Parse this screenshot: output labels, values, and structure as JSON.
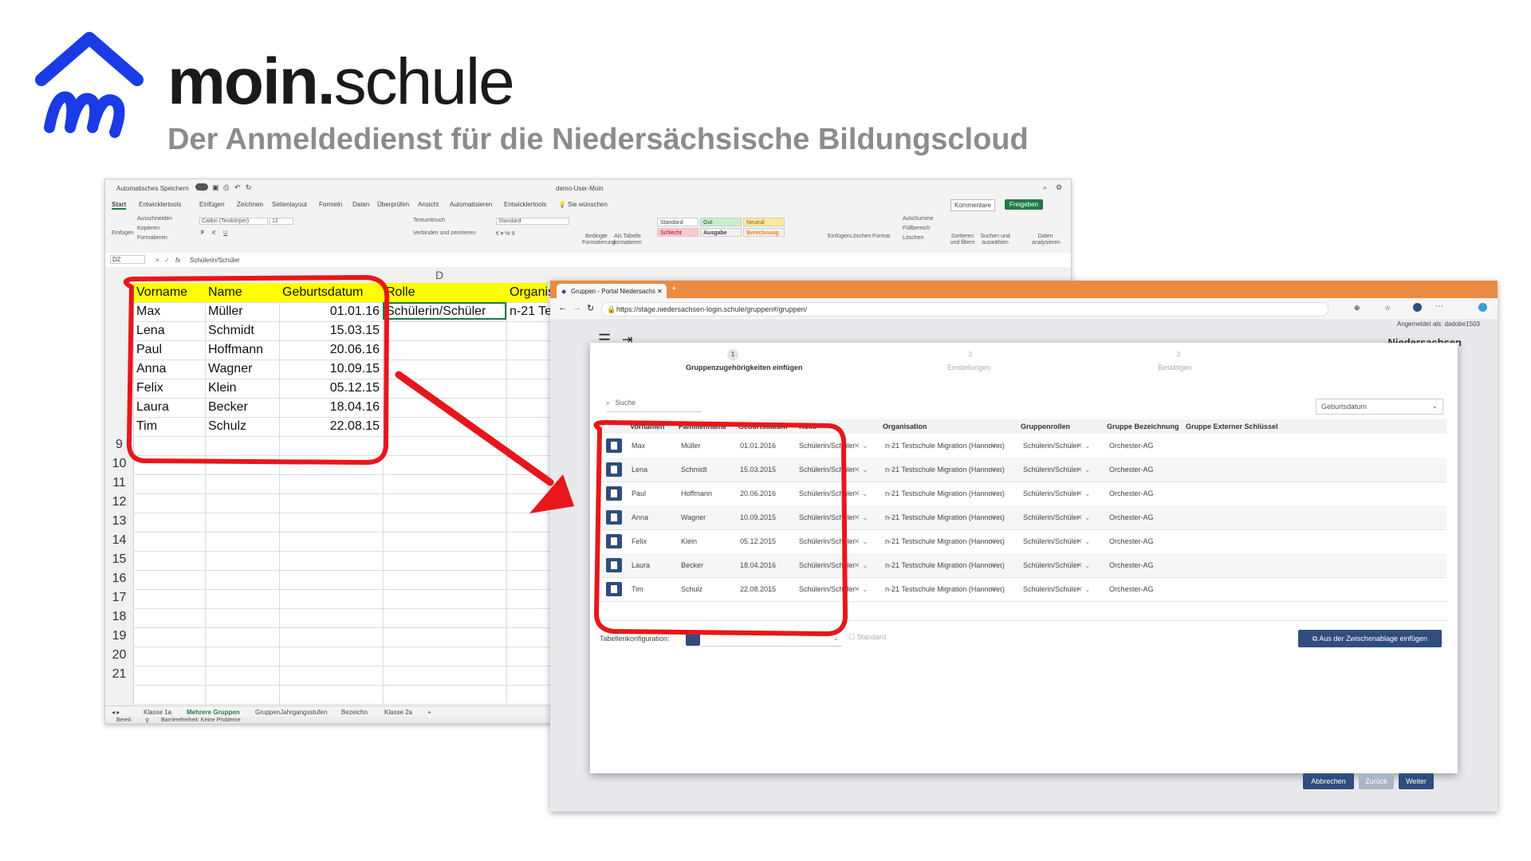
{
  "header": {
    "brand_bold": "moin.",
    "brand_light": "schule",
    "tagline": "Der Anmeldedienst für die Niedersächsische Bildungscloud"
  },
  "excel": {
    "autosave": "Automatisches Speichern",
    "filename": "demo-User-Moin",
    "tabs": [
      "Start",
      "Entwicklertools",
      "Einfügen",
      "Zeichnen",
      "Seitenlayout",
      "Formeln",
      "Daten",
      "Überprüfen",
      "Ansicht",
      "Automatisieren",
      "Entwicklertools"
    ],
    "tell_me": "Sie wünschen",
    "comments": "Kommentare",
    "share": "Freigeben",
    "clipboard": [
      "Ausschneiden",
      "Kopieren",
      "Formatieren"
    ],
    "paste": "Einfügen",
    "font_name": "Calibri (Textkörper)",
    "font_size": "12",
    "wrap": "Textumbruch",
    "merge": "Verbinden und zentrieren",
    "number_format": "Standard",
    "cond_format": "Bedingte Formatierung",
    "as_table": "Als Tabelle formatieren",
    "styles": {
      "standard": "Standard",
      "gut": "Gut",
      "neutral": "Neutral",
      "schlecht": "Schlecht",
      "ausgabe": "Ausgabe",
      "berechnung": "Berechnung"
    },
    "cells_group": [
      "Einfügen",
      "Löschen",
      "Format"
    ],
    "autosum": "AutoSumme",
    "fill": "Füllbereich",
    "clear": "Löschen",
    "sort": "Sortieren und filtern",
    "find": "Suchen und auswählen",
    "analyze": "Daten analysieren",
    "cell_ref": "D2",
    "fx": "fx",
    "formula": "Schülerin/Schüler",
    "col_d": "D",
    "headers": [
      "Vorname",
      "Name",
      "Geburtsdatum",
      "Rolle",
      "Organis"
    ],
    "rows": [
      {
        "vorname": "Max",
        "name": "Müller",
        "datum": "01.01.16",
        "rolle": "Schülerin/Schüler",
        "org": "n-21 Te"
      },
      {
        "vorname": "Lena",
        "name": "Schmidt",
        "datum": "15.03.15"
      },
      {
        "vorname": "Paul",
        "name": "Hoffmann",
        "datum": "20.06.16"
      },
      {
        "vorname": "Anna",
        "name": "Wagner",
        "datum": "10.09.15"
      },
      {
        "vorname": "Felix",
        "name": "Klein",
        "datum": "05.12.15"
      },
      {
        "vorname": "Laura",
        "name": "Becker",
        "datum": "18.04.16"
      },
      {
        "vorname": "Tim",
        "name": "Schulz",
        "datum": "22.08.15"
      }
    ],
    "row_numbers": [
      "9",
      "10",
      "11",
      "12",
      "13",
      "14",
      "15",
      "16",
      "17",
      "18",
      "19",
      "20",
      "21"
    ],
    "sheet_tabs": [
      "Klasse 1a",
      "Mehrere Gruppen",
      "GruppenJahrgangsstufen",
      "Bezeichn",
      "Klasse 2a",
      "+"
    ],
    "status": "Bereit",
    "accessibility": "Barrierefreiheit: Keine Probleme"
  },
  "browser": {
    "tab_title": "Gruppen - Portal Niedersachs",
    "url": "https://stage.niedersachsen-login.schule/gruppen#/gruppen/",
    "logged_in": "Angemeldet als: dadobe1503",
    "state_name": "Niedersachsen",
    "steps": [
      {
        "num": "1",
        "label": "Gruppenzugehörigkeiten einfügen"
      },
      {
        "num": "2",
        "label": "Einstellungen"
      },
      {
        "num": "3",
        "label": "Bestätigen"
      }
    ],
    "search_placeholder": "Suche",
    "sort_value": "Geburtsdatum",
    "columns": [
      "Vornamen",
      "Familienname",
      "Geburtsdatum",
      "Rolle",
      "Organisation",
      "Gruppenrollen",
      "Gruppe Bezeichnung",
      "Gruppe Externer Schlüssel"
    ],
    "rows": [
      {
        "vorname": "Max",
        "familienname": "Müller",
        "geburtsdatum": "01.01.2016",
        "rolle": "Schülerin/Schüler",
        "organisation": "n-21 Testschule Migration (Hannover)",
        "gruppenrolle": "Schülerin/Schüler",
        "gruppe": "Orchester-AG"
      },
      {
        "vorname": "Lena",
        "familienname": "Schmidt",
        "geburtsdatum": "15.03.2015",
        "rolle": "Schülerin/Schüler",
        "organisation": "n-21 Testschule Migration (Hannover)",
        "gruppenrolle": "Schülerin/Schüler",
        "gruppe": "Orchester-AG"
      },
      {
        "vorname": "Paul",
        "familienname": "Hoffmann",
        "geburtsdatum": "20.06.2016",
        "rolle": "Schülerin/Schüler",
        "organisation": "n-21 Testschule Migration (Hannover)",
        "gruppenrolle": "Schülerin/Schüler",
        "gruppe": "Orchester-AG"
      },
      {
        "vorname": "Anna",
        "familienname": "Wagner",
        "geburtsdatum": "10.09.2015",
        "rolle": "Schülerin/Schüler",
        "organisation": "n-21 Testschule Migration (Hannover)",
        "gruppenrolle": "Schülerin/Schüler",
        "gruppe": "Orchester-AG"
      },
      {
        "vorname": "Felix",
        "familienname": "Klein",
        "geburtsdatum": "05.12.2015",
        "rolle": "Schülerin/Schüler",
        "organisation": "n-21 Testschule Migration (Hannover)",
        "gruppenrolle": "Schülerin/Schüler",
        "gruppe": "Orchester-AG"
      },
      {
        "vorname": "Laura",
        "familienname": "Becker",
        "geburtsdatum": "18.04.2016",
        "rolle": "Schülerin/Schüler",
        "organisation": "n-21 Testschule Migration (Hannover)",
        "gruppenrolle": "Schülerin/Schüler",
        "gruppe": "Orchester-AG"
      },
      {
        "vorname": "Tim",
        "familienname": "Schulz",
        "geburtsdatum": "22.08.2015",
        "rolle": "Schülerin/Schüler",
        "organisation": "n-21 Testschule Migration (Hannover)",
        "gruppenrolle": "Schülerin/Schüler",
        "gruppe": "Orchester-AG"
      }
    ],
    "table_config_label": "Tabellenkonfiguration:",
    "standard_label": "Standard",
    "paste_button": "Aus der Zwischenablage einfügen",
    "cancel_button": "Abbrechen",
    "back_button": "Zurück",
    "next_button": "Weiter",
    "colors": {
      "accent": "#2f4d7e",
      "topbar": "#e98b42",
      "annotation": "#e8161a",
      "brand_blue": "#1a3be6"
    }
  }
}
